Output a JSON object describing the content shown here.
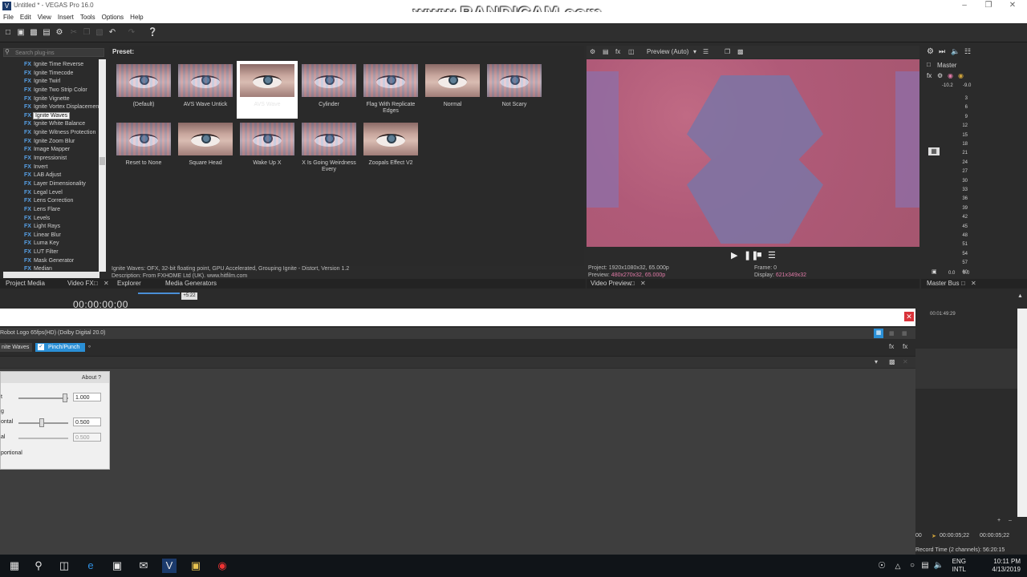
{
  "window": {
    "title": "Untitled * - VEGAS Pro 16.0",
    "logo": "V"
  },
  "watermark": "www.BANDICAM.com",
  "menu": [
    "File",
    "Edit",
    "View",
    "Insert",
    "Tools",
    "Options",
    "Help"
  ],
  "plugins": {
    "search_placeholder": "Search plug-ins",
    "items": [
      "Ignite Time Reverse",
      "Ignite Timecode",
      "Ignite Twirl",
      "Ignite Two Strip Color",
      "Ignite Vignette",
      "Ignite Vortex Displacement",
      "Ignite Waves",
      "Ignite White Balance",
      "Ignite Witness Protection",
      "Ignite Zoom Blur",
      "Image Mapper",
      "Impressionist",
      "Invert",
      "LAB Adjust",
      "Layer Dimensionality",
      "Legal Level",
      "Lens Correction",
      "Lens Flare",
      "Levels",
      "Light Rays",
      "Linear Blur",
      "Luma Key",
      "LUT Filter",
      "Mask Generator",
      "Median"
    ],
    "selected": "Ignite Waves",
    "fx_badge": "FX"
  },
  "presets": {
    "title": "Preset:",
    "items": [
      "(Default)",
      "AVS Wave Untick",
      "AVS Wave",
      "Cylinder",
      "Flag With Replicate Edges",
      "Normal",
      "Not Scary",
      "Reset to None",
      "Square Head",
      "Wake Up X",
      "X Is Going Weirdness Every",
      "Zoopals Effect V2"
    ],
    "selected": "AVS Wave",
    "description_line1": "Ignite Waves: OFX, 32-bit floating point, GPU Accelerated, Grouping Ignite - Distort, Version 1.2",
    "description_line2": "Description: From FXHOME Ltd (UK). www.hitfilm.com"
  },
  "preview": {
    "mode": "Preview (Auto)",
    "project_label": "Project:",
    "project_value": "1920x1080x32, 65.000p",
    "preview_label": "Preview:",
    "preview_value": "480x270x32, 65.000p",
    "frame_label": "Frame:",
    "frame_value": "0",
    "display_label": "Display:",
    "display_value": "621x349x32"
  },
  "master": {
    "title": "Master",
    "levels_left": "-10.2",
    "levels_right": "-9.0",
    "ticks": [
      "3",
      "6",
      "9",
      "12",
      "15",
      "18",
      "21",
      "24",
      "27",
      "30",
      "33",
      "36",
      "39",
      "42",
      "45",
      "48",
      "51",
      "54",
      "57",
      "60"
    ],
    "bottom_left": "0.0",
    "bottom_right": "0.0"
  },
  "tabs": {
    "left": [
      "Project Media",
      "Video FX",
      "Explorer",
      "Media Generators"
    ],
    "preview": "Video Preview",
    "master": "Master Bus"
  },
  "timeline": {
    "timecode": "00:00:00;00",
    "ruler_badge": "+5:22",
    "ruler_time": "00:01:49:29",
    "time_a": "00:00:05;22",
    "time_b": "00:00:05;22",
    "time_left": "00",
    "record_time": "Record Time (2 channels): 56:20:15"
  },
  "fx_window": {
    "chain_title": "Robot Logo 65fps(HD) (Dolby Digital 20.0)",
    "chip1": "nite Waves",
    "chip2": "Pinch/Punch",
    "about": "About",
    "params": [
      {
        "label": "t",
        "value": "1.000",
        "dim": false
      },
      {
        "label": "ontal",
        "value": "0.500",
        "dim": false
      },
      {
        "label": "al",
        "value": "0.500",
        "dim": true
      }
    ],
    "slider_fractions": [
      1.0,
      0.5,
      0.5
    ],
    "proportional_label": "portional",
    "row_g": "g"
  },
  "tray": {
    "lang1": "ENG",
    "lang2": "INTL",
    "time": "10:11 PM",
    "date": "4/13/2019"
  }
}
